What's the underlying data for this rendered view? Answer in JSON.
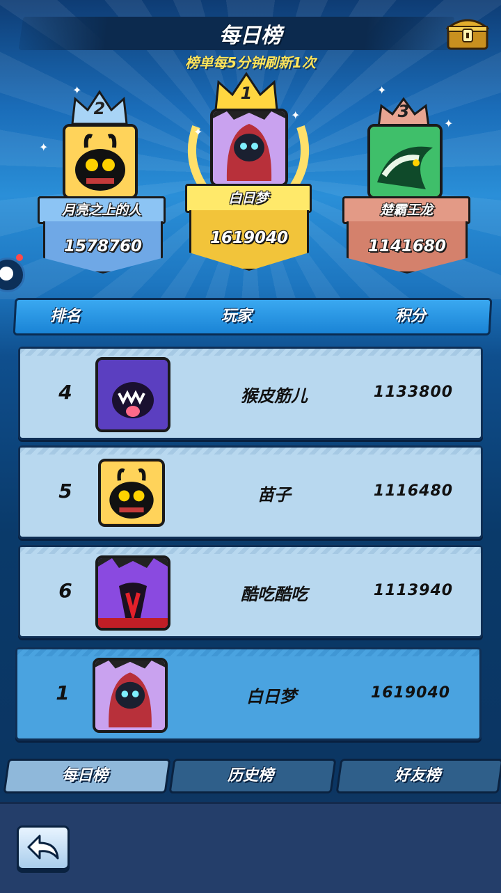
{
  "header": {
    "title": "每日榜",
    "subtitle": "榜单每5分钟刷新1次"
  },
  "podium": [
    {
      "rank": "2",
      "name": "月亮之上的人",
      "score": "1578760",
      "avatar_icon": "black-bug-monster-icon",
      "ribbon_color": "#8cc4f4",
      "shield_color": "#6fa8e6"
    },
    {
      "rank": "1",
      "name": "白日梦",
      "score": "1619040",
      "avatar_icon": "hooded-ghost-icon",
      "ribbon_color": "#ffe96a",
      "shield_color": "#f2c43a"
    },
    {
      "rank": "3",
      "name": "楚霸王龙",
      "score": "1141680",
      "avatar_icon": "green-dragon-icon",
      "ribbon_color": "#e39a86",
      "shield_color": "#d4816c"
    }
  ],
  "columns": {
    "rank": "排名",
    "player": "玩家",
    "score": "积分"
  },
  "rows": [
    {
      "rank": "4",
      "name": "猴皮筋儿",
      "score": "1133800",
      "avatar_icon": "purple-shark-icon"
    },
    {
      "rank": "5",
      "name": "苗子",
      "score": "1116480",
      "avatar_icon": "black-bug-monster-icon"
    },
    {
      "rank": "6",
      "name": "酷吃酷吃",
      "score": "1113940",
      "avatar_icon": "purple-demon-icon"
    }
  ],
  "self_row": {
    "rank": "1",
    "name": "白日梦",
    "score": "1619040",
    "avatar_icon": "hooded-ghost-icon"
  },
  "tabs": [
    {
      "label": "每日榜",
      "active": true
    },
    {
      "label": "历史榜",
      "active": false
    },
    {
      "label": "好友榜",
      "active": false
    }
  ],
  "icons": {
    "chest": "treasure-chest-icon",
    "back": "back-arrow-icon"
  },
  "colors": {
    "gold": "#f2c43a",
    "silver_blue": "#6fa8e6",
    "bronze": "#d4816c",
    "accent": "#ffe45a"
  }
}
